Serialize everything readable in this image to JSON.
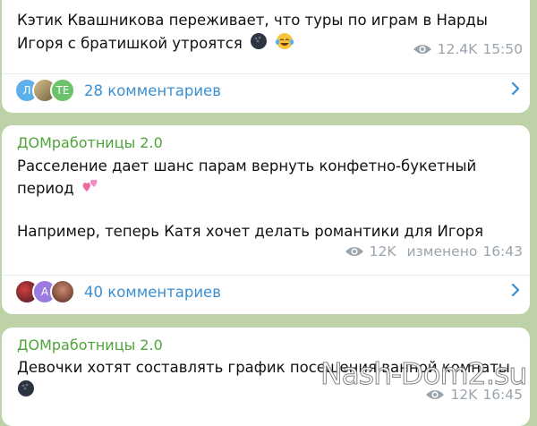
{
  "posts": [
    {
      "channel": "ДОМработницы 2.0",
      "lines": [
        "Кэтик Квашникова переживает, что туры по играм в Нарды",
        "Игоря с братишкой утроятся"
      ],
      "emojis": [
        "bowling-ball-emoji",
        "laughing-tears-emoji"
      ],
      "views": "12.4K",
      "time": "15:50",
      "comments": {
        "avatars": [
          {
            "letter": "Л",
            "color": "#5fb0e8"
          },
          {
            "letter": "",
            "color": "#b0a070"
          },
          {
            "letter": "ТЕ",
            "color": "#6cc16b"
          }
        ],
        "label": "28 комментариев"
      }
    },
    {
      "channel": "ДОМработницы 2.0",
      "lines": [
        "Расселение дает шанс парам вернуть конфетно-букетный",
        "период",
        "",
        "Например, теперь Катя хочет делать романтики для Игоря"
      ],
      "emojis": [
        "two-hearts-emoji"
      ],
      "views": "12K",
      "edited": "изменено",
      "time": "16:43",
      "comments": {
        "avatars": [
          {
            "letter": "",
            "color": "#a3333a"
          },
          {
            "letter": "А",
            "color": "#9b7be0"
          },
          {
            "letter": "",
            "color": "#9a5a48"
          }
        ],
        "label": "40 комментариев"
      }
    },
    {
      "channel": "ДОМработницы 2.0",
      "lines": [
        "Девочки хотят составлять график посещения ванной комнаты"
      ],
      "emojis": [
        "bowling-ball-emoji"
      ],
      "views": "12K",
      "time": "16:45"
    }
  ],
  "watermark": "Nash-Dom2.su",
  "colors": {
    "accent": "#3b8fd0",
    "channel": "#4fa43b",
    "background": "#bdd3a7"
  }
}
